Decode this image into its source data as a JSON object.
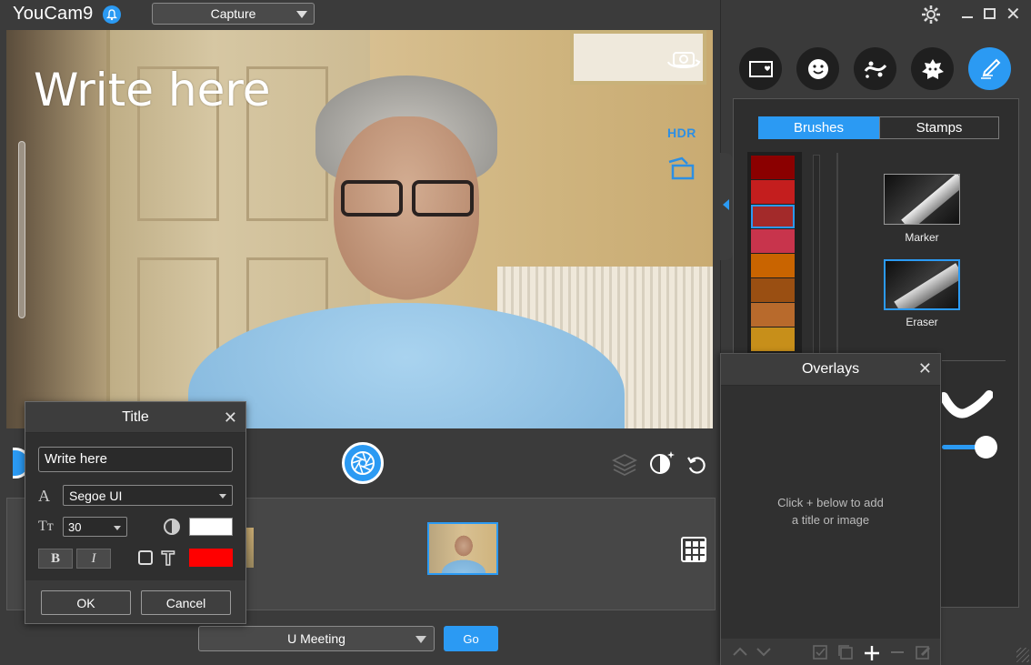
{
  "app": {
    "title": "YouCam9",
    "mode": "Capture"
  },
  "video": {
    "overlay_text": "Write here",
    "hdr_label": "HDR"
  },
  "title_dialog": {
    "title": "Title",
    "close": "✕",
    "text_value": "Write here",
    "font_icon": "A",
    "font_value": "Segoe UI",
    "size_icon": "Tт",
    "size_value": "30",
    "bold_label": "B",
    "italic_label": "I",
    "outline_icon": "T",
    "fill_color": "#ffffff",
    "outline_color": "#ff0000",
    "ok_label": "OK",
    "cancel_label": "Cancel"
  },
  "bottom": {
    "meeting_value": "U Meeting",
    "go_label": "Go"
  },
  "right_panel": {
    "tabs": {
      "brushes": "Brushes",
      "stamps": "Stamps"
    },
    "tools": [
      "frame-icon",
      "smiley-icon",
      "particle-icon",
      "distortion-icon",
      "brush-icon"
    ],
    "palette": [
      "#8b0000",
      "#c41e1e",
      "#a32a2a",
      "#c8344c",
      "#c96400",
      "#9a4f12",
      "#b86a2c",
      "#c78f1a"
    ],
    "brushes": [
      {
        "label": "Marker"
      },
      {
        "label": "Eraser"
      }
    ],
    "accent": "#2b9af3"
  },
  "overlays": {
    "title": "Overlays",
    "close": "✕",
    "hint_line1": "Click + below to add",
    "hint_line2": "a title or image",
    "toolbar": [
      "up-icon",
      "down-icon",
      "check-icon",
      "copy-icon",
      "add-icon",
      "remove-icon",
      "edit-icon"
    ]
  }
}
